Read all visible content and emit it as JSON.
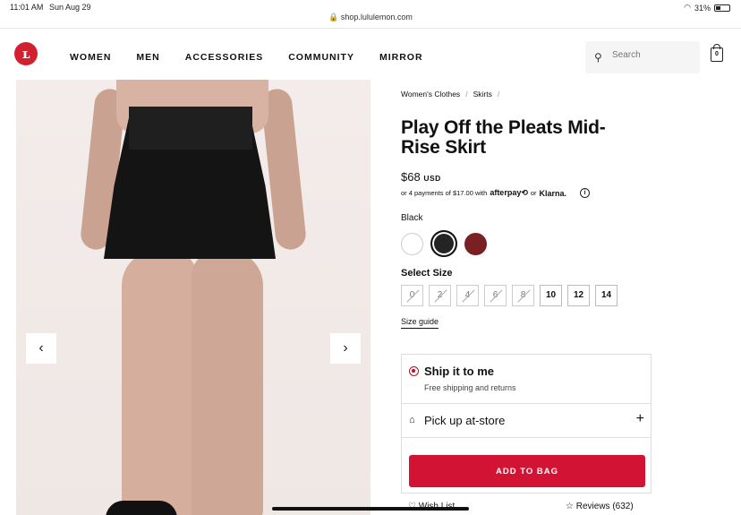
{
  "status_bar": {
    "time": "11:01 AM",
    "date": "Sun Aug 29",
    "url": "shop.lululemon.com",
    "battery": "31%"
  },
  "nav": {
    "logo_glyph": "ʟ",
    "links": [
      "WOMEN",
      "MEN",
      "ACCESSORIES",
      "COMMUNITY",
      "MIRROR"
    ],
    "search_placeholder": "Search",
    "bag_count": "0"
  },
  "gallery": {
    "prev_icon": "‹",
    "next_icon": "›"
  },
  "product": {
    "breadcrumbs": [
      "Women's Clothes",
      "Skirts"
    ],
    "title": "Play Off the Pleats Mid-Rise Skirt",
    "price": "$68",
    "currency": "USD",
    "installments_text": "or 4 payments of $17.00 with",
    "afterpay": "afterpay⟲",
    "or": "or",
    "klarna": "Klarna.",
    "color_name": "Black",
    "swatches": [
      {
        "name": "white",
        "color": "#ffffff"
      },
      {
        "name": "black",
        "color": "#242424"
      },
      {
        "name": "burgundy",
        "color": "#7a1f24"
      }
    ],
    "size_label": "Select Size",
    "sizes": [
      {
        "label": "0",
        "available": false
      },
      {
        "label": "2",
        "available": false
      },
      {
        "label": "4",
        "available": false
      },
      {
        "label": "6",
        "available": false
      },
      {
        "label": "8",
        "available": false
      },
      {
        "label": "10",
        "available": true
      },
      {
        "label": "12",
        "available": true
      },
      {
        "label": "14",
        "available": true
      }
    ],
    "size_guide": "Size guide"
  },
  "fulfillment": {
    "ship_title": "Ship it to me",
    "ship_sub": "Free shipping and returns",
    "pickup_title": "Pick up at-store",
    "add_to_bag": "ADD TO BAG"
  },
  "bottom": {
    "wishlist": "Wish List",
    "reviews": "Reviews (632)"
  },
  "colors": {
    "accent": "#d31334"
  }
}
